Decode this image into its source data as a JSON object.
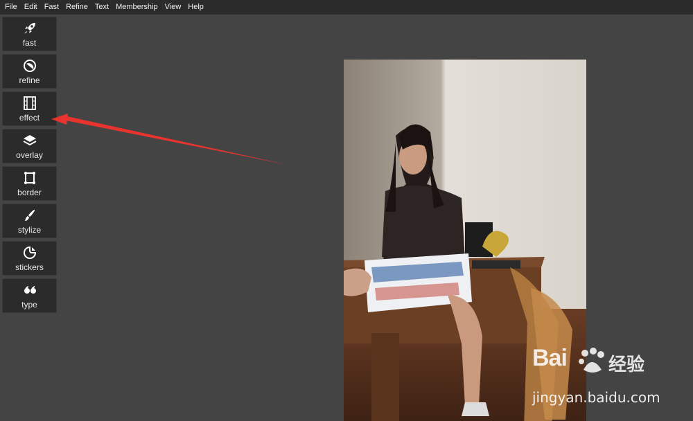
{
  "menubar": {
    "items": [
      "File",
      "Edit",
      "Fast",
      "Refine",
      "Text",
      "Membership",
      "View",
      "Help"
    ]
  },
  "toolbar": {
    "tools": [
      {
        "label": "fast",
        "icon": "rocket-icon"
      },
      {
        "label": "refine",
        "icon": "refine-circle-icon"
      },
      {
        "label": "effect",
        "icon": "film-strip-icon"
      },
      {
        "label": "overlay",
        "icon": "layers-icon"
      },
      {
        "label": "border",
        "icon": "frame-icon"
      },
      {
        "label": "stylize",
        "icon": "brush-icon"
      },
      {
        "label": "stickers",
        "icon": "sticker-icon"
      },
      {
        "label": "type",
        "icon": "quote-icon"
      }
    ]
  },
  "annotation": {
    "color": "#e8332f"
  },
  "watermark": {
    "brand": "Bai",
    "brand_cn": "经验",
    "url": "jingyan.baidu.com"
  }
}
